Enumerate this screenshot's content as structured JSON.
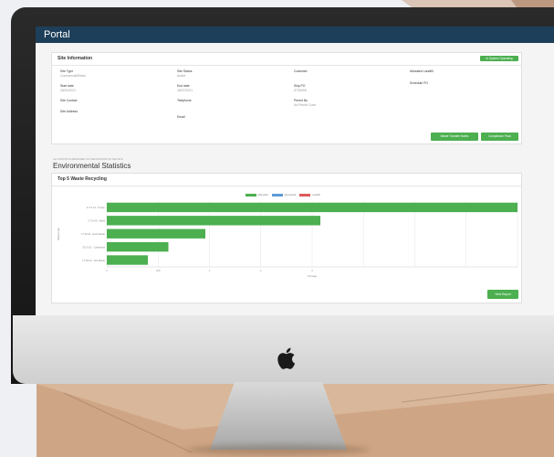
{
  "app": {
    "title": "Portal"
  },
  "site_information": {
    "heading": "Site Information",
    "status_badge": "In System Operating",
    "fields": {
      "site_type_label": "Site Type",
      "site_type_value": "Commercial/Retail",
      "site_status_label": "Site Status",
      "site_status_value": "Active",
      "customer_label": "Customer",
      "allocated_landfill_label": "Allocated Landfill",
      "start_date_label": "Start date",
      "start_date_value": "18/01/2021",
      "end_date_label": "End date",
      "end_date_value": "18/07/2021",
      "skip_po_label": "Skip PO",
      "skip_po_value": "S735495",
      "schedule_po_label": "Schedule PO",
      "site_contact_label": "Site Contact",
      "telephone_label": "Telephone",
      "permit_no_label": "Permit No",
      "permit_no_value": "No Permit Code",
      "site_address_label": "Site Address",
      "email_label": "Email"
    },
    "buttons": {
      "waste_transfer": "Waste Transfer Notes",
      "compliance": "Compliance Pack"
    }
  },
  "environmental": {
    "pre_heading": "ALL STATISTICS ARE BASED ON THE DURATION OF THE SITE",
    "heading": "Environmental Statistics"
  },
  "recycling_card": {
    "heading": "Top 5 Waste Recycling",
    "view_report": "View Report"
  },
  "colors": {
    "recycled": "#4caf50",
    "recovered": "#5b9bd5",
    "landfill": "#e05a5a",
    "topbar": "#1e3f5a"
  },
  "chart_data": {
    "type": "bar",
    "orientation": "horizontal",
    "categories": [
      "17 01 01 - Timber",
      "17 04 05 - Metal",
      "17 09 04 - Hard Waste",
      "20 01 01 - Cardboard",
      "17 05 04 - Soil Waste"
    ],
    "series": [
      {
        "name": "Recycled",
        "values": [
          100,
          52,
          24,
          15,
          10
        ]
      },
      {
        "name": "Recovered",
        "values": [
          0,
          0,
          0,
          0,
          0
        ]
      },
      {
        "name": "Landfill",
        "values": [
          0,
          0,
          0,
          0,
          0
        ]
      }
    ],
    "xticks": [
      "0",
      "100",
      "1",
      "2",
      "3"
    ],
    "xlabel": "Tonnage",
    "ylabel": "Waste Type",
    "xlim": [
      0,
      100
    ],
    "grid": true,
    "legend_position": "top-center"
  }
}
